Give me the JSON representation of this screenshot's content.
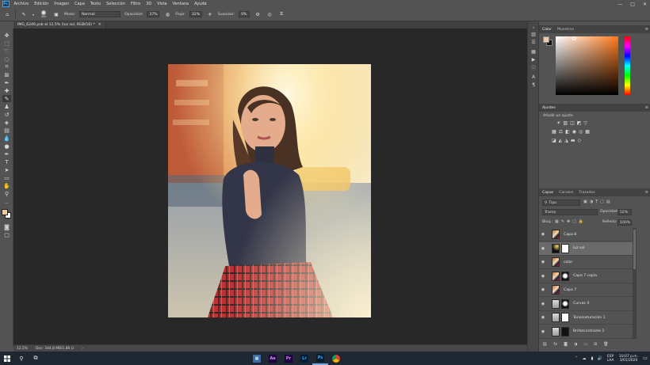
{
  "menubar": {
    "logo": "Ps",
    "items": [
      "Archivo",
      "Edición",
      "Imagen",
      "Capa",
      "Texto",
      "Selección",
      "Filtro",
      "3D",
      "Vista",
      "Ventana",
      "Ayuda"
    ],
    "window_controls": [
      "—",
      "□",
      "✕"
    ]
  },
  "options": {
    "brush_size": "300",
    "mode_label": "Modo:",
    "mode_value": "Normal",
    "opacity_label": "Opacidad:",
    "opacity_value": "37%",
    "flow_label": "Flujo:",
    "flow_value": "32%",
    "smooth_label": "Suavizar:",
    "smooth_value": "0%"
  },
  "document": {
    "tab_title": "IMG_6246.psb al 12,5% (luz sol, RGB/16) *",
    "zoom": "12,5%",
    "doc_info": "Doc: 344,8 MB/1,86 G"
  },
  "color_panel": {
    "tabs": [
      "Color",
      "Muestras"
    ],
    "foreground": "#f2c9a3",
    "hue_base": "#ff7a1a"
  },
  "adjust_panel": {
    "tabs": [
      "Ajustes"
    ],
    "subtitle": "Añadir un ajuste"
  },
  "layers_panel": {
    "tabs": [
      "Capas",
      "Canales",
      "Trazados"
    ],
    "filter_label": "Tipo",
    "blend_mode": "Trama",
    "opacity_label": "Opacidad:",
    "opacity_value": "52%",
    "lock_label": "Bloq.:",
    "fill_label": "Relleno:",
    "fill_value": "100%",
    "layers": [
      {
        "name": "Capa 8",
        "thumb": "photo",
        "mask": false,
        "selected": false
      },
      {
        "name": "luz sol",
        "thumb": "dark",
        "mask": true,
        "selected": true
      },
      {
        "name": "color",
        "thumb": "photo",
        "mask": false,
        "selected": false
      },
      {
        "name": "Capa 7 copia",
        "thumb": "photo",
        "mask": true,
        "selected": false
      },
      {
        "name": "Capa 7",
        "thumb": "photo",
        "mask": false,
        "selected": false
      },
      {
        "name": "Curvas 4",
        "thumb": "adj",
        "mask": true,
        "selected": false
      },
      {
        "name": "Tono/saturación 1",
        "thumb": "adj",
        "mask": true,
        "selected": false
      },
      {
        "name": "Brillo/contraste 1",
        "thumb": "adj",
        "mask": true,
        "selected": false
      }
    ]
  },
  "taskbar": {
    "lang_line1": "ESP",
    "lang_line2": "LAA",
    "time": "10:07 p.m.",
    "date": "3/01/2020",
    "apps": [
      "Ae",
      "Pr",
      "Lr",
      "Ps"
    ]
  }
}
